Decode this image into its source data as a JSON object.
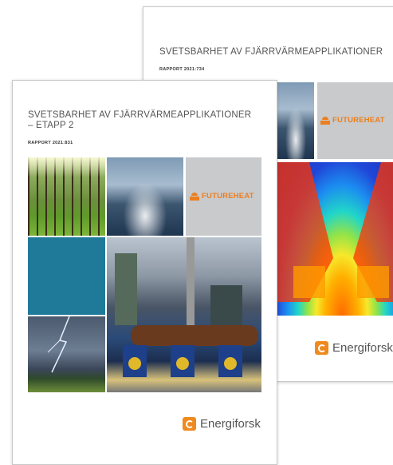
{
  "back_cover": {
    "title": "SVETSBARHET AV FJÄRRVÄRMEAPPLIKATIONER",
    "report_number": "RAPPORT 2021:734",
    "futureheat_logo": "FUTUREHEAT",
    "energiforsk_logo": "Energiforsk"
  },
  "front_cover": {
    "title_line1": "SVETSBARHET AV FJÄRRVÄRMEAPPLIKATIONER",
    "title_line2": "– ETAPP 2",
    "report_number": "RAPPORT 2021:831",
    "futureheat_logo": "FUTUREHEAT",
    "energiforsk_logo": "Energiforsk"
  },
  "colors": {
    "futureheat_orange": "#ec7f1e",
    "energiforsk_orange": "#ee8a1e",
    "teal_tile": "#1f7a9a",
    "grey_tile": "#c8cacc"
  }
}
